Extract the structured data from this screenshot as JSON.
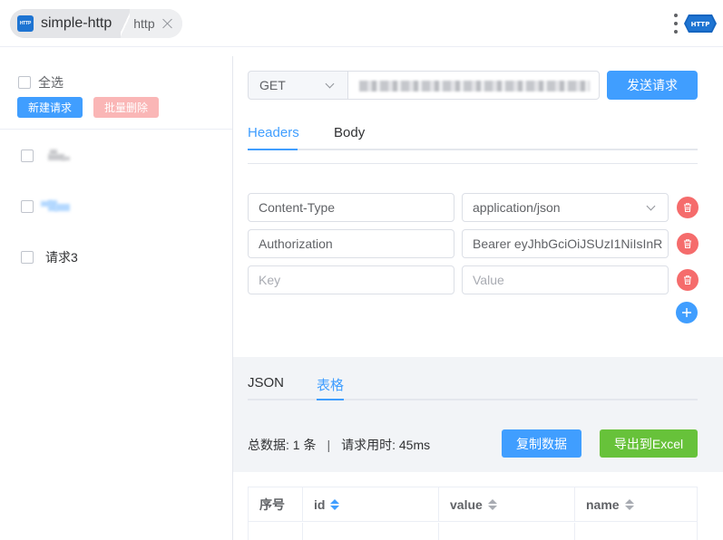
{
  "app": {
    "title": "simple-http",
    "tab_label": "http",
    "logo_text": "HTTP",
    "icon_text": "HTTP"
  },
  "sidebar": {
    "select_all_label": "全选",
    "new_request_label": "新建请求",
    "batch_delete_label": "批量删除",
    "items": [
      {
        "label": ""
      },
      {
        "label": ""
      },
      {
        "label": "请求3"
      }
    ]
  },
  "request": {
    "method": "GET",
    "send_label": "发送请求",
    "tabs": [
      {
        "label": "Headers",
        "active": true
      },
      {
        "label": "Body",
        "active": false
      }
    ],
    "headers": [
      {
        "key": "Content-Type",
        "value": "application/json",
        "value_is_select": true
      },
      {
        "key": "Authorization",
        "value": "Bearer eyJhbGciOiJSUzI1NiIsInR"
      },
      {
        "key": "",
        "value": "",
        "key_placeholder": "Key",
        "value_placeholder": "Value"
      }
    ]
  },
  "response": {
    "tabs": [
      {
        "label": "JSON",
        "active": false
      },
      {
        "label": "表格",
        "active": true
      }
    ],
    "stats": {
      "total_label": "总数据: 1 条",
      "separator": "|",
      "time_label": "请求用时: 45ms"
    },
    "copy_label": "复制数据",
    "export_label": "导出到Excel",
    "table": {
      "columns": [
        {
          "label": "序号",
          "sortable": false
        },
        {
          "label": "id",
          "sortable": true,
          "sort_active": true
        },
        {
          "label": "value",
          "sortable": true
        },
        {
          "label": "name",
          "sortable": true
        }
      ]
    }
  },
  "colors": {
    "primary": "#409eff",
    "danger": "#f56c6c",
    "success": "#67c23a",
    "danger_light": "#fab6b6"
  },
  "icons": {
    "app": "http-app-icon",
    "close": "close-icon",
    "more": "more-vertical-icon",
    "logo": "http-logo-icon",
    "delete": "trash-icon",
    "add": "plus-icon",
    "dropdown": "chevron-down-icon",
    "sort": "sort-caret-icon"
  }
}
